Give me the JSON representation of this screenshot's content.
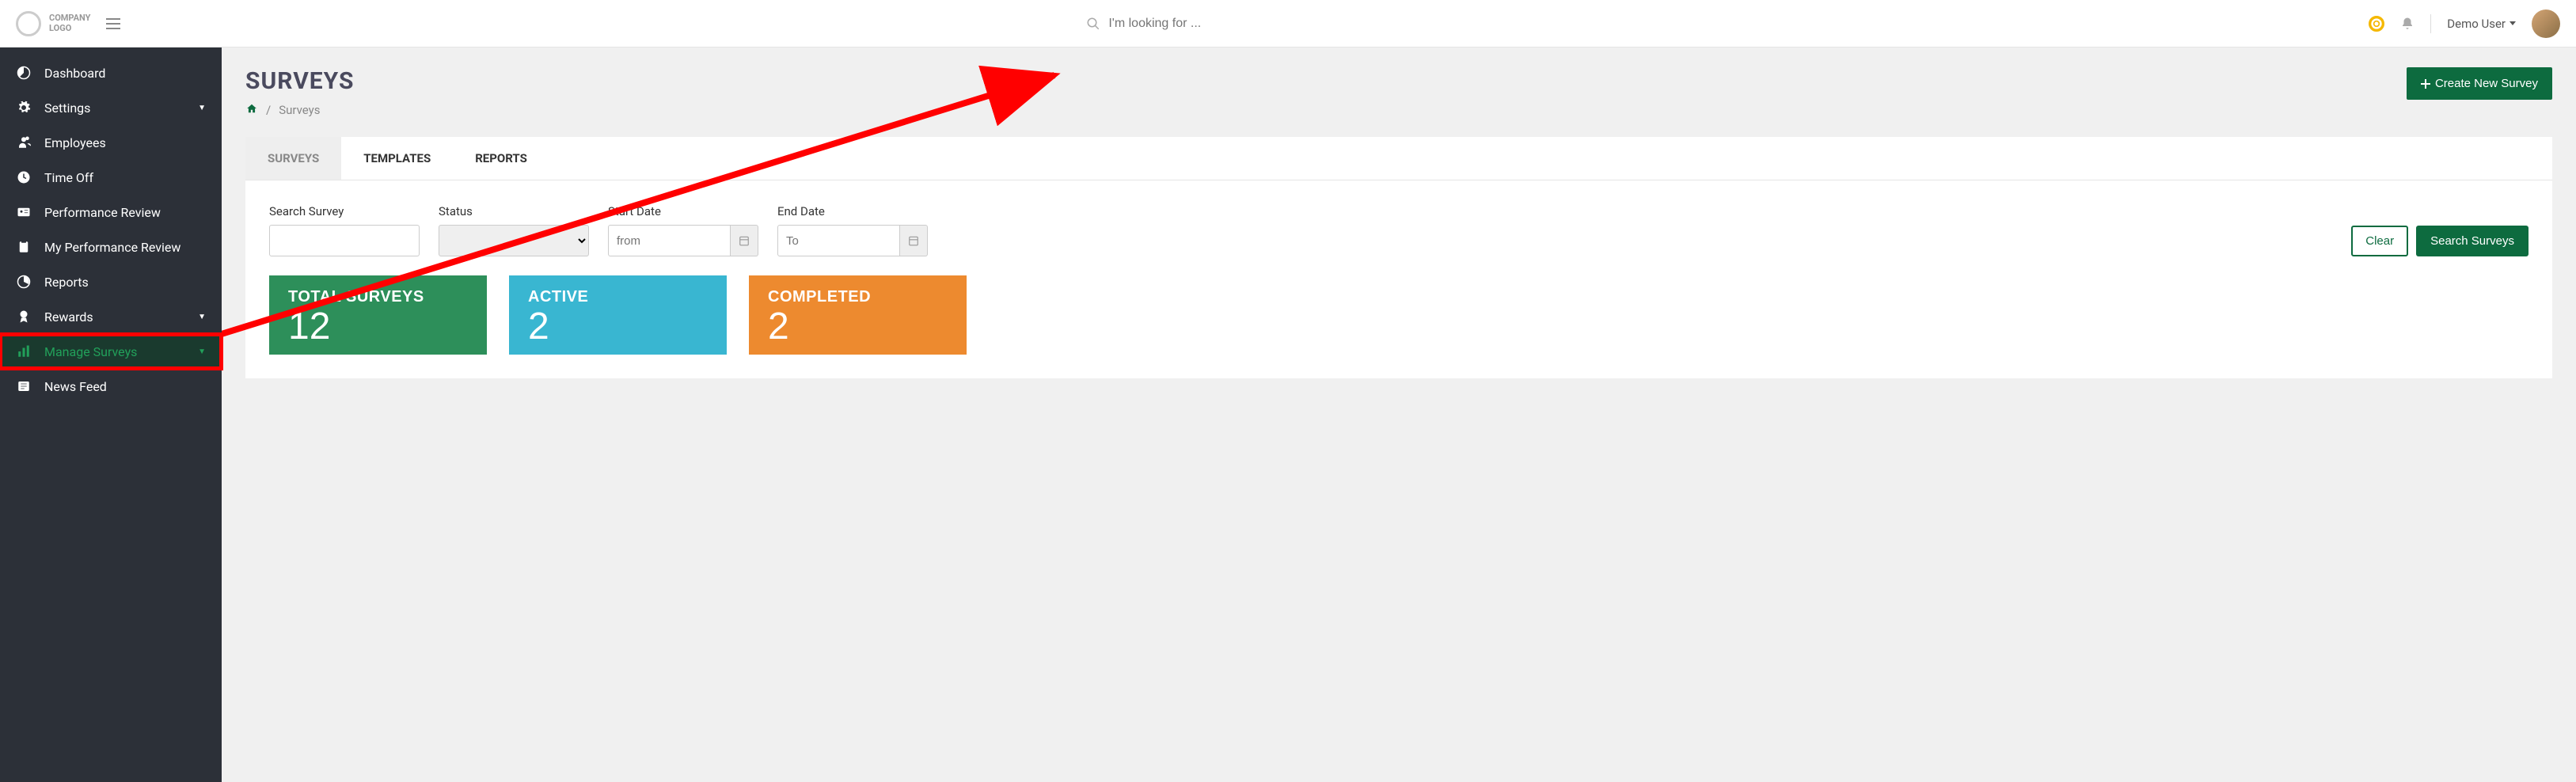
{
  "header": {
    "logo_text": "COMPANY\nLOGO",
    "search_placeholder": "I'm looking for ...",
    "user_name": "Demo User"
  },
  "sidebar": {
    "items": [
      {
        "label": "Dashboard",
        "icon": "dashboard"
      },
      {
        "label": "Settings",
        "icon": "gear",
        "caret": true
      },
      {
        "label": "Employees",
        "icon": "users"
      },
      {
        "label": "Time Off",
        "icon": "clock"
      },
      {
        "label": "Performance Review",
        "icon": "id-card"
      },
      {
        "label": "My Performance Review",
        "icon": "clipboard"
      },
      {
        "label": "Reports",
        "icon": "pie"
      },
      {
        "label": "Rewards",
        "icon": "award",
        "caret": true
      },
      {
        "label": "Manage Surveys",
        "icon": "bar",
        "caret": true,
        "active": true,
        "highlighted": true
      },
      {
        "label": "News Feed",
        "icon": "news"
      }
    ]
  },
  "page": {
    "title": "SURVEYS",
    "breadcrumb_current": "Surveys",
    "create_button": "Create New Survey"
  },
  "tabs": [
    {
      "label": "SURVEYS",
      "active": true
    },
    {
      "label": "TEMPLATES"
    },
    {
      "label": "REPORTS"
    }
  ],
  "filters": {
    "search_label": "Search Survey",
    "status_label": "Status",
    "start_label": "Start Date",
    "start_placeholder": "from",
    "end_label": "End Date",
    "end_placeholder": "To",
    "clear_label": "Clear",
    "search_button": "Search Surveys"
  },
  "stats": [
    {
      "title": "TOTAL SURVEYS",
      "value": "12",
      "color": "green"
    },
    {
      "title": "ACTIVE",
      "value": "2",
      "color": "blue"
    },
    {
      "title": "COMPLETED",
      "value": "2",
      "color": "orange"
    }
  ]
}
